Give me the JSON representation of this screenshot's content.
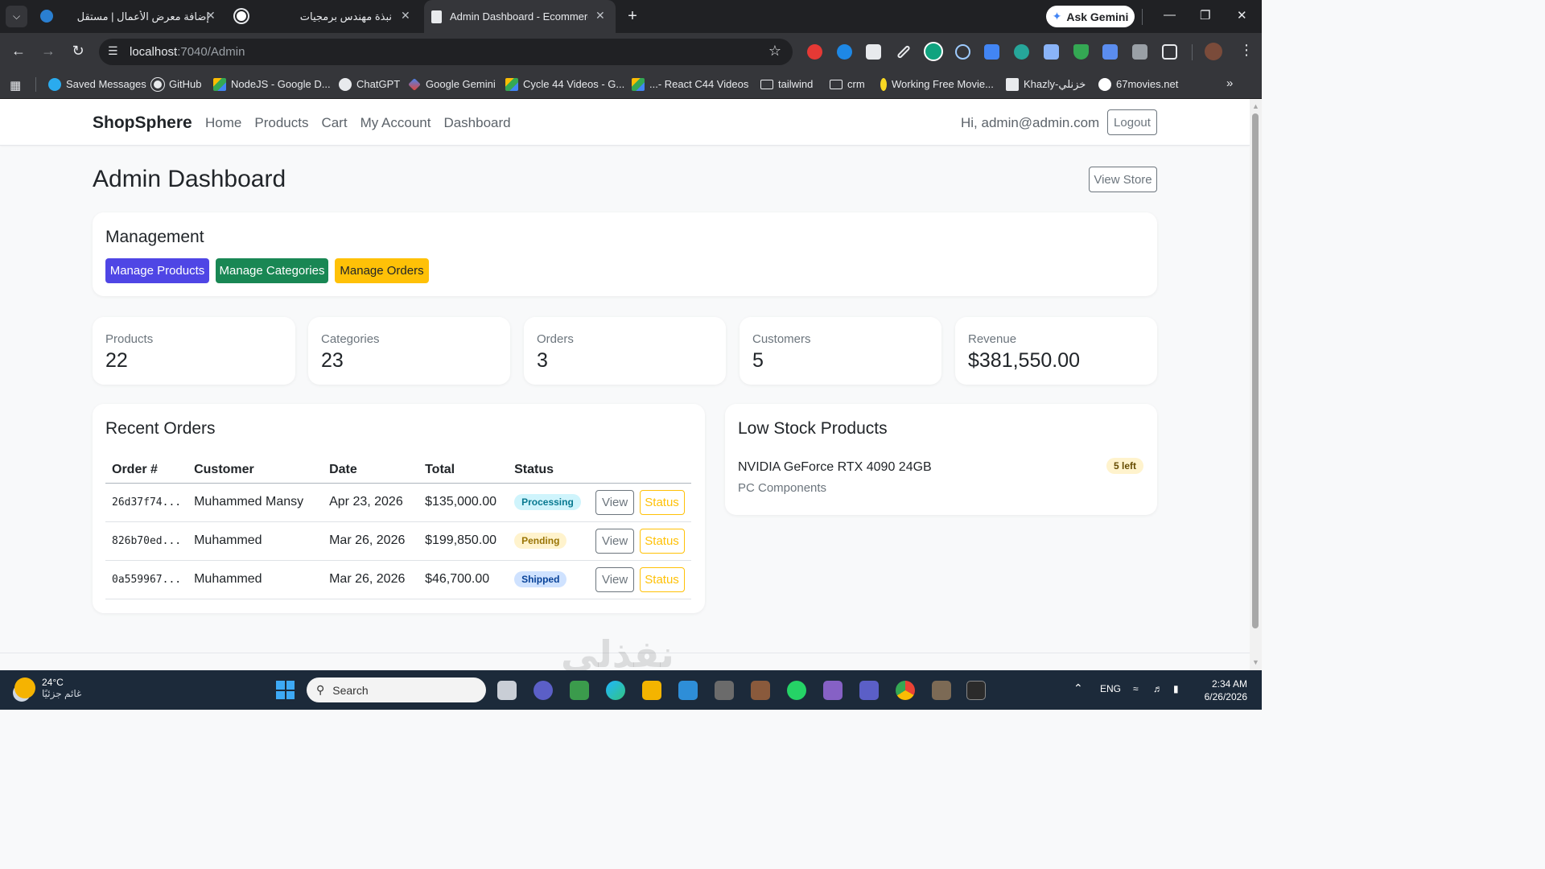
{
  "browser": {
    "tabs": [
      {
        "title": "إضافة معرض الأعمال | مستقل",
        "active": false
      },
      {
        "title": "نبذة مهندس برمجيات",
        "active": false
      },
      {
        "title": "Admin Dashboard - Ecommerce",
        "active": true
      }
    ],
    "ask_gemini": "Ask Gemini",
    "url_host": "localhost",
    "url_path": ":7040/Admin",
    "bookmarks": [
      "Saved Messages",
      "GitHub",
      "NodeJS - Google D...",
      "ChatGPT",
      "Google Gemini",
      "Cycle 44 Videos - G...",
      "...- React C44 Videos",
      "tailwind",
      "crm",
      "Working Free Movie...",
      "Khazly-خزنلي",
      "67movies.net"
    ]
  },
  "site": {
    "brand": "ShopSphere",
    "nav": [
      "Home",
      "Products",
      "Cart",
      "My Account",
      "Dashboard"
    ],
    "greeting": "Hi, admin@admin.com",
    "logout": "Logout"
  },
  "page": {
    "title": "Admin Dashboard",
    "view_store": "View Store"
  },
  "management": {
    "heading": "Management",
    "buttons": [
      {
        "label": "Manage Products",
        "color": "#4f46e5"
      },
      {
        "label": "Manage Categories",
        "color": "#198754"
      },
      {
        "label": "Manage Orders",
        "color": "#ffc107"
      }
    ]
  },
  "stats": [
    {
      "label": "Products",
      "value": "22"
    },
    {
      "label": "Categories",
      "value": "23"
    },
    {
      "label": "Orders",
      "value": "3"
    },
    {
      "label": "Customers",
      "value": "5"
    },
    {
      "label": "Revenue",
      "value": "$381,550.00"
    }
  ],
  "recent_orders": {
    "heading": "Recent Orders",
    "columns": [
      "Order #",
      "Customer",
      "Date",
      "Total",
      "Status"
    ],
    "rows": [
      {
        "id": "26d37f74...",
        "customer": "Muhammed Mansy",
        "date": "Apr 23, 2026",
        "total": "$135,000.00",
        "status": "Processing",
        "status_bg": "#cff4fc",
        "status_fg": "#087990"
      },
      {
        "id": "826b70ed...",
        "customer": "Muhammed",
        "date": "Mar 26, 2026",
        "total": "$199,850.00",
        "status": "Pending",
        "status_bg": "#fff3cd",
        "status_fg": "#997404"
      },
      {
        "id": "0a559967...",
        "customer": "Muhammed",
        "date": "Mar 26, 2026",
        "total": "$46,700.00",
        "status": "Shipped",
        "status_bg": "#cfe2ff",
        "status_fg": "#084298"
      }
    ],
    "view_label": "View",
    "status_label": "Status"
  },
  "low_stock": {
    "heading": "Low Stock Products",
    "items": [
      {
        "name": "NVIDIA GeForce RTX 4090 24GB",
        "category": "PC Components",
        "badge": "5 left"
      }
    ]
  },
  "watermark": "نفذلي",
  "taskbar": {
    "temperature": "24°C",
    "weather_text": "غائم جزئيًا",
    "search_placeholder": "Search",
    "language": "ENG",
    "time": "2:34 AM",
    "date": "6/26/2026"
  }
}
